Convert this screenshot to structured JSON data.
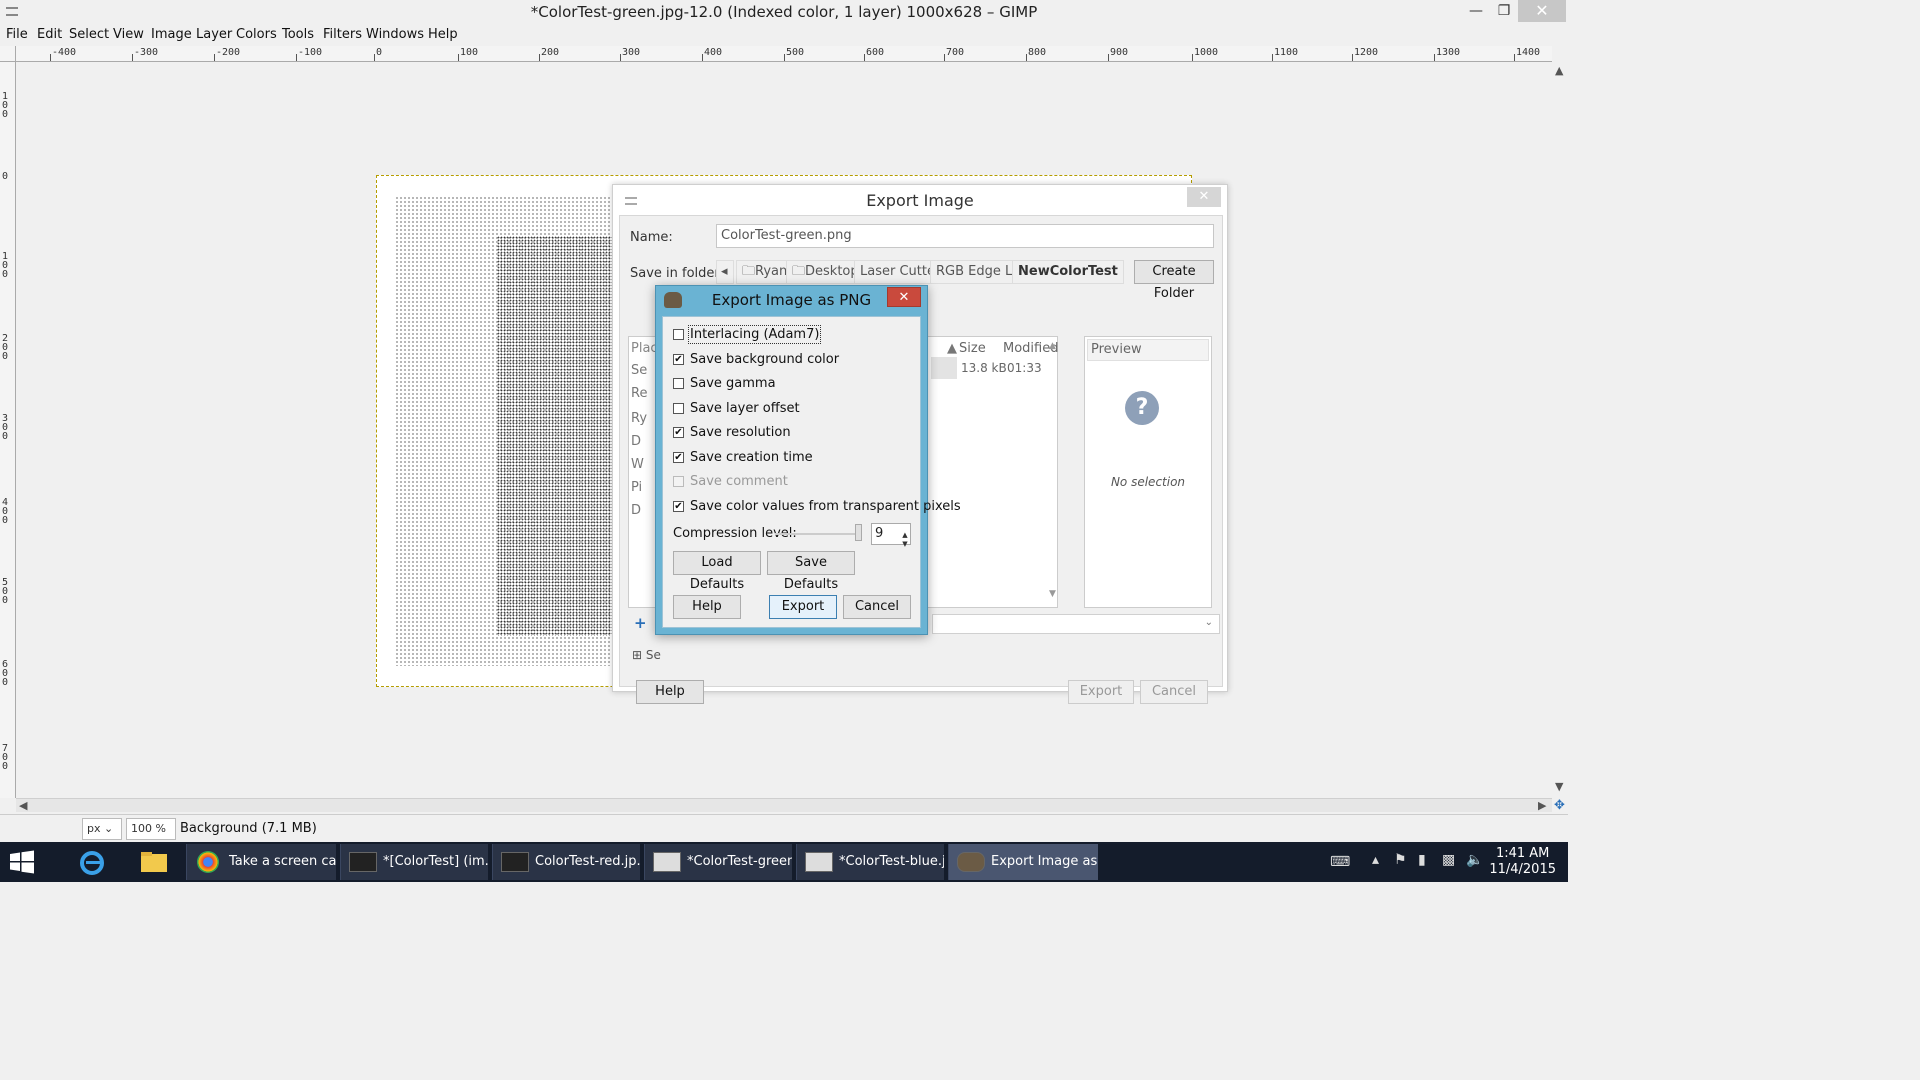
{
  "window": {
    "title": "*ColorTest-green.jpg-12.0 (Indexed color, 1 layer) 1000x628 – GIMP",
    "minimize_glyph": "—",
    "maximize_glyph": "❐",
    "close_glyph": "✕"
  },
  "menu": [
    "File",
    "Edit",
    "Select",
    "View",
    "Image",
    "Layer",
    "Colors",
    "Tools",
    "Filters",
    "Windows",
    "Help"
  ],
  "ruler": {
    "h_labels": [
      "-400",
      "-300",
      "-200",
      "-100",
      "0",
      "100",
      "200",
      "300",
      "400",
      "500",
      "600",
      "700",
      "800",
      "900",
      "1000",
      "1100",
      "1200",
      "1300",
      "1400"
    ],
    "v_labels": [
      "100",
      "0",
      "100",
      "200",
      "300",
      "400",
      "500",
      "600",
      "700"
    ]
  },
  "statusbar": {
    "unit": "px",
    "zoom": "100 %",
    "text": "Background (7.1 MB)"
  },
  "export_dialog": {
    "title": "Export Image",
    "name_label": "Name:",
    "name_value": "ColorTest-green.png",
    "folder_label": "Save in folder:",
    "breadcrumbs": [
      "Ryan",
      "Desktop",
      "Laser Cutter",
      "RGB Edge Lit",
      "NewColorTest"
    ],
    "create_folder": "Create Folder",
    "places_header": "Plac",
    "places_items": [
      "Se",
      "Re",
      "Ry",
      "D",
      "W",
      "Pi",
      "D"
    ],
    "columns": {
      "size": "Size",
      "modified": "Modified"
    },
    "file_row": {
      "size": "13.8 kB",
      "modified": "01:33"
    },
    "preview_header": "Preview",
    "preview_icon": "?",
    "preview_text": "No selection",
    "select_type": "Se",
    "help_button": "Help",
    "export_button": "Export",
    "cancel_button": "Cancel"
  },
  "png_dialog": {
    "title": "Export Image as PNG",
    "options": [
      {
        "label": "Interlacing (Adam7)",
        "checked": false,
        "disabled": false,
        "focus": true
      },
      {
        "label": "Save background color",
        "checked": true,
        "disabled": false
      },
      {
        "label": "Save gamma",
        "checked": false,
        "disabled": false
      },
      {
        "label": "Save layer offset",
        "checked": false,
        "disabled": false
      },
      {
        "label": "Save resolution",
        "checked": true,
        "disabled": false
      },
      {
        "label": "Save creation time",
        "checked": true,
        "disabled": false
      },
      {
        "label": "Save comment",
        "checked": false,
        "disabled": true
      },
      {
        "label": "Save color values from transparent pixels",
        "checked": true,
        "disabled": false
      }
    ],
    "compression_label": "Compression level:",
    "compression_value": "9",
    "load_defaults": "Load Defaults",
    "save_defaults": "Save Defaults",
    "help_button": "Help",
    "export_button": "Export",
    "cancel_button": "Cancel"
  },
  "taskbar": {
    "items": [
      {
        "label": "Take a screen ca..."
      },
      {
        "label": "*[ColorTest] (im..."
      },
      {
        "label": "ColorTest-red.jp..."
      },
      {
        "label": "*ColorTest-green..."
      },
      {
        "label": "*ColorTest-blue.j..."
      },
      {
        "label": "Export Image as ..."
      }
    ],
    "time": "1:41 AM",
    "date": "11/4/2015"
  },
  "colors": {
    "png_title_bar": "#6ab3d3",
    "close_button": "#c94a3d",
    "taskbar": "#141c2b",
    "selection_border": "#b59d00"
  }
}
